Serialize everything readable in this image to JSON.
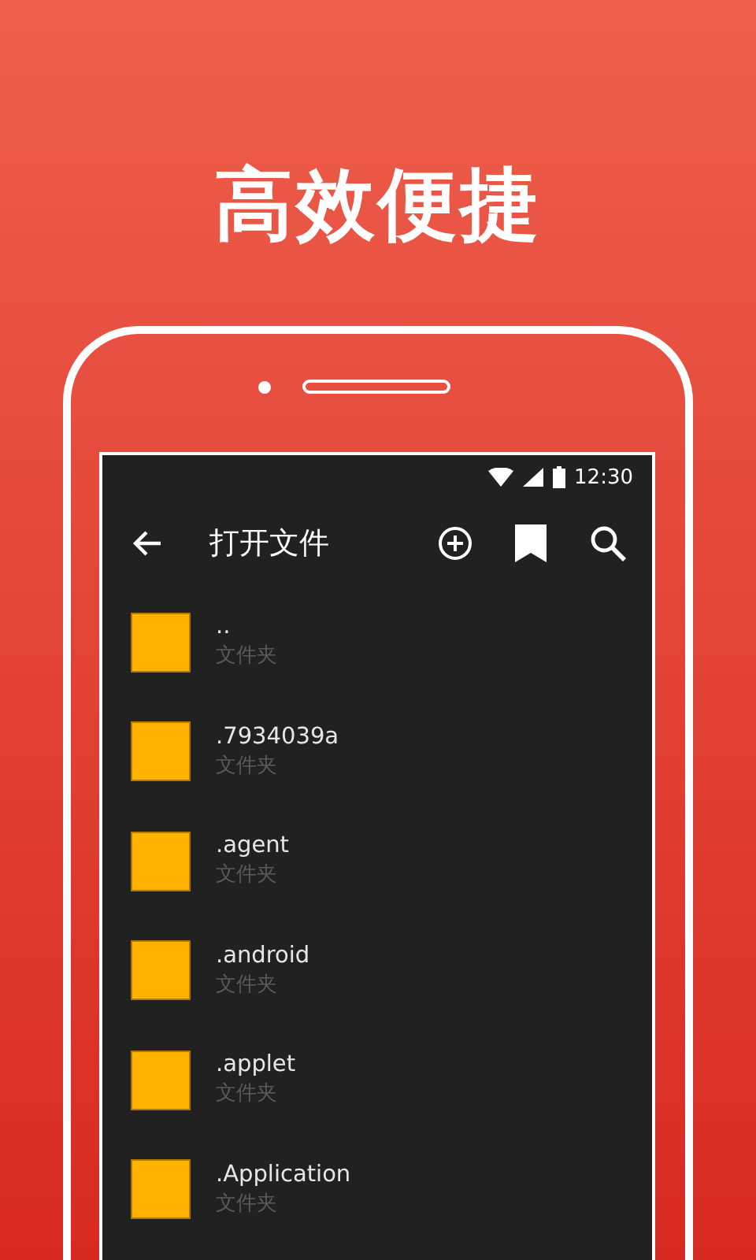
{
  "headline": "高效便捷",
  "status_bar": {
    "time": "12:30"
  },
  "toolbar": {
    "title": "打开文件"
  },
  "files": [
    {
      "name": "..",
      "type": "文件夹"
    },
    {
      "name": ".7934039a",
      "type": "文件夹"
    },
    {
      "name": ".agent",
      "type": "文件夹"
    },
    {
      "name": ".android",
      "type": "文件夹"
    },
    {
      "name": ".applet",
      "type": "文件夹"
    },
    {
      "name": ".Application",
      "type": "文件夹"
    }
  ]
}
